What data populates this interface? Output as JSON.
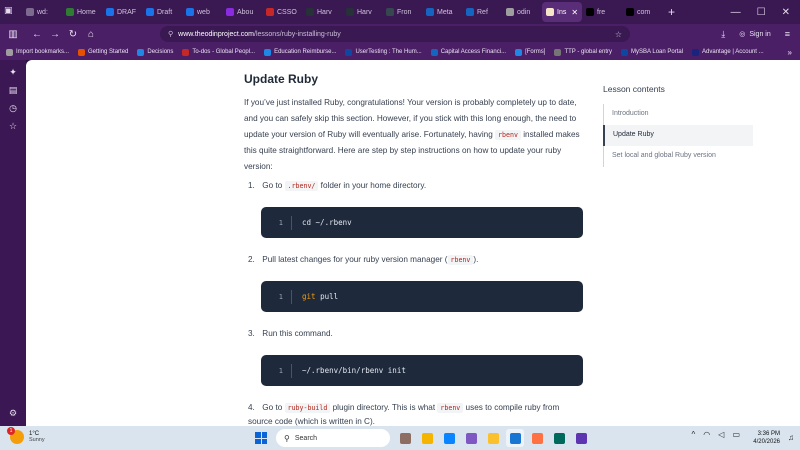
{
  "browser": {
    "tabs": [
      {
        "label": "wd:",
        "color": "#7d6b8f"
      },
      {
        "label": "Home",
        "color": "#2e7d32"
      },
      {
        "label": "DRAF",
        "color": "#1a73e8"
      },
      {
        "label": "Draft",
        "color": "#1a73e8"
      },
      {
        "label": "web",
        "color": "#1a73e8"
      },
      {
        "label": "Abou",
        "color": "#8a2be2"
      },
      {
        "label": "CSSO",
        "color": "#c62828"
      },
      {
        "label": "Harv",
        "color": "#263238"
      },
      {
        "label": "Harv",
        "color": "#263238"
      },
      {
        "label": "Fron",
        "color": "#37474f"
      },
      {
        "label": "Meta",
        "color": "#1565c0"
      },
      {
        "label": "Ref",
        "color": "#1565c0"
      },
      {
        "label": "odin",
        "color": "#9e9e9e"
      },
      {
        "label": "Ins",
        "color": "#f5e6c8",
        "active": true
      },
      {
        "label": "fre",
        "color": "#000000"
      },
      {
        "label": "com",
        "color": "#000000"
      }
    ],
    "url_host": "www.theodinproject.com",
    "url_path": "/lessons/ruby-installing-ruby",
    "signin_label": "Sign in",
    "bookmarks": [
      {
        "label": "Import bookmarks...",
        "color": "#9e9e9e"
      },
      {
        "label": "Getting Started",
        "color": "#e65100"
      },
      {
        "label": "Decisions",
        "color": "#1e88e5"
      },
      {
        "label": "To-dos - Global Peopl...",
        "color": "#c62828"
      },
      {
        "label": "Education Reimburse...",
        "color": "#1e88e5"
      },
      {
        "label": "UserTesting : The Hum...",
        "color": "#0d47a1"
      },
      {
        "label": "Capital Access Financi...",
        "color": "#1565c0"
      },
      {
        "label": "[Forms]",
        "color": "#1e88e5"
      },
      {
        "label": "TTP - global entry",
        "color": "#757575"
      },
      {
        "label": "MySBA Loan Portal",
        "color": "#0d47a1"
      },
      {
        "label": "Advantage | Account ...",
        "color": "#1a237e"
      }
    ]
  },
  "lesson": {
    "title": "Update Ruby",
    "para_1": "If you’ve just installed Ruby, congratulations! Your version is probably completely up to date, and you can safely skip this section. However, if you stick with this long enough, the need to update your version of Ruby will eventually arise. Fortunately, having",
    "para_code": "rbenv",
    "para_2": "installed makes this quite straightforward. Here are step by step instructions on how to update your ruby version:",
    "steps": [
      {
        "num": "1.",
        "pre": "Go to",
        "code": ".rbenv/",
        "post": "folder in your home directory.",
        "line": "1",
        "cmd": "cd ~/.rbenv"
      },
      {
        "num": "2.",
        "pre": "Pull latest changes for your ruby version manager (",
        "code": "rbenv",
        "post": ").",
        "line": "1",
        "cmd_kw": "git",
        "cmd": "pull"
      },
      {
        "num": "3.",
        "pre": "Run this command.",
        "line": "1",
        "cmd": "~/.rbenv/bin/rbenv init"
      },
      {
        "num": "4.",
        "pre": "Go to",
        "code": "ruby-build",
        "mid": "plugin directory. This is what",
        "code2": "rbenv",
        "post": "uses to compile ruby from source code (which is written in C)."
      }
    ]
  },
  "toc": {
    "title": "Lesson contents",
    "items": [
      "Introduction",
      "Update Ruby",
      "Set local and global Ruby version"
    ]
  },
  "taskbar": {
    "temp": "1°C",
    "condition": "Sunny",
    "badge": "1",
    "search_label": "Search",
    "time": "3:36 PM",
    "date": "4/20/2026",
    "apps": [
      "#8d6e63",
      "#f4b400",
      "#0a84ff",
      "#7e57c2",
      "#fbc02d",
      "#1976d2",
      "#ff7043",
      "#00695c",
      "#5e35b1"
    ]
  }
}
